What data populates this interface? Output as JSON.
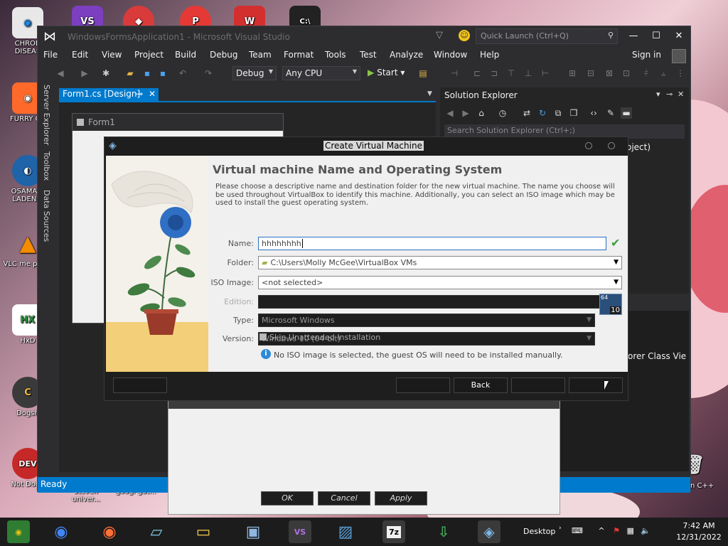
{
  "desktop": {
    "icons": [
      {
        "label": "CHRON DISEAS",
        "color": "#e8e8e8",
        "glyph": "G"
      },
      {
        "label": "FURRY CU",
        "color": "#ff6a2b",
        "glyph": "F"
      },
      {
        "label": "OSAMA B LADEN E",
        "color": "#1f63a8",
        "glyph": "O"
      },
      {
        "label": "VLC me playe",
        "color": "#f48b00",
        "glyph": "▲"
      },
      {
        "label": "HxD",
        "color": "#ffffff",
        "glyph": "HX"
      },
      {
        "label": "Dogsh",
        "color": "#3a3a3a",
        "glyph": "C"
      },
      {
        "label": "Not Doge",
        "color": "#c62828",
        "glyph": "DEV"
      }
    ],
    "top_icons": [
      {
        "color": "#7b3fbf",
        "glyph": "VS"
      },
      {
        "color": "#d93b3b",
        "glyph": "◆"
      },
      {
        "color": "#e53935",
        "glyph": "P"
      },
      {
        "color": "#d32f2f",
        "glyph": "W"
      },
      {
        "color": "#222222",
        "glyph": "C:\\"
      }
    ],
    "bottom_labels": [
      "steven univer...",
      "googl gat..."
    ],
    "recycle_label": "Falcon C++"
  },
  "vs": {
    "title": "WindowsFormsApplication1 - Microsoft Visual Studio",
    "quick_launch": "Quick Launch (Ctrl+Q)",
    "menu": [
      "File",
      "Edit",
      "View",
      "Project",
      "Build",
      "Debug",
      "Team",
      "Format",
      "Tools",
      "Test",
      "Analyze",
      "Window",
      "Help"
    ],
    "sign_in": "Sign in",
    "config": "Debug",
    "platform": "Any CPU",
    "start": "Start",
    "left_tabs": [
      "Server Explorer",
      "Toolbox",
      "Data Sources"
    ],
    "doc_tab": "Form1.cs [Design]",
    "form_title": "Form1",
    "solution_explorer": "Solution Explorer",
    "sol_search": "Search Solution Explorer (Ctrl+;)",
    "sol_project_fragment": "oject)",
    "bottom_tabs": "orer  Class Vie",
    "status": "Ready"
  },
  "props": {
    "ok": "OK",
    "cancel": "Cancel",
    "apply": "Apply"
  },
  "vbox": {
    "title": "Create Virtual Machine",
    "heading": "Virtual machine Name and Operating System",
    "description": "Please choose a descriptive name and destination folder for the new virtual machine. The name you choose will be used throughout VirtualBox to identify this machine. Additionally, you can select an ISO image which may be used to install the guest operating system.",
    "fields": {
      "name_label": "Name:",
      "name_value": "hhhhhhhh",
      "folder_label": "Folder:",
      "folder_value": "C:\\Users\\Molly McGee\\VirtualBox VMs",
      "iso_label": "ISO Image:",
      "iso_value": "<not selected>",
      "edition_label": "Edition:",
      "edition_value": "",
      "type_label": "Type:",
      "type_value": "Microsoft Windows",
      "version_label": "Version:",
      "version_value": "Windows 10 (64-bit)"
    },
    "os_badge_64": "64",
    "os_badge_10": "10",
    "skip_label": "Skip Unattended Installation",
    "info": "No ISO image is selected, the guest OS will need to be installed manually.",
    "back": "Back"
  },
  "taskbar": {
    "desktop_label": "Desktop",
    "time": "7:42 AM",
    "date": "12/31/2022",
    "apps": [
      {
        "name": "chrome-old",
        "color": "#2e7d32",
        "glyph": "◉"
      },
      {
        "name": "chrome",
        "color": "#ffffff",
        "glyph": "◉"
      },
      {
        "name": "firefox",
        "color": "#ff7139",
        "glyph": "◉"
      },
      {
        "name": "notepad",
        "color": "#7fc8e8",
        "glyph": "▱"
      },
      {
        "name": "explorer",
        "color": "#f2c94c",
        "glyph": "▭"
      },
      {
        "name": "network",
        "color": "#8fb7e0",
        "glyph": "▣"
      },
      {
        "name": "visual-studio",
        "color": "#8e44ad",
        "glyph": "VS"
      },
      {
        "name": "photos",
        "color": "#5aa0d8",
        "glyph": "▨"
      },
      {
        "name": "7zip",
        "color": "#f0f0f0",
        "glyph": "7z"
      },
      {
        "name": "download",
        "color": "#3fae5a",
        "glyph": "⇩"
      },
      {
        "name": "virtualbox",
        "color": "#7fb6e6",
        "glyph": "◈"
      }
    ]
  }
}
